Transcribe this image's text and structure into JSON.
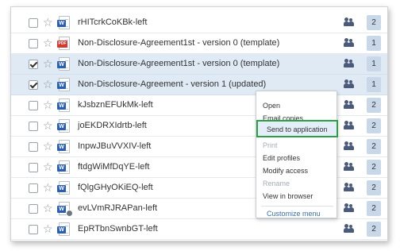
{
  "files": [
    {
      "name": "rHITcrkCoKBk-left",
      "type": "docx",
      "checked": false,
      "version": "2",
      "locked": false
    },
    {
      "name": "Non-Disclosure-Agreement1st - version 0 (template)",
      "type": "pdf",
      "checked": false,
      "version": "1",
      "locked": false
    },
    {
      "name": "Non-Disclosure-Agreement1st - version 0 (template)",
      "type": "docx",
      "checked": true,
      "version": "1",
      "locked": false
    },
    {
      "name": "Non-Disclosure-Agreement - version 1 (updated)",
      "type": "docx",
      "checked": true,
      "version": "1",
      "locked": false
    },
    {
      "name": "kJsbznEFUkMk-left",
      "type": "docx",
      "checked": false,
      "version": "2",
      "locked": false
    },
    {
      "name": "joEKDRXIdrtb-left",
      "type": "docx",
      "checked": false,
      "version": "2",
      "locked": false
    },
    {
      "name": "InpwJBuVVXIV-left",
      "type": "docx",
      "checked": false,
      "version": "2",
      "locked": false
    },
    {
      "name": "ftdgWiMfDqYE-left",
      "type": "docx",
      "checked": false,
      "version": "2",
      "locked": false
    },
    {
      "name": "fQlgGHyOKiEQ-left",
      "type": "docx",
      "checked": false,
      "version": "2",
      "locked": false
    },
    {
      "name": "evLVmRJRAPan-left",
      "type": "docx",
      "checked": false,
      "version": "2",
      "locked": true
    },
    {
      "name": "EpRTbnSwnbGT-left",
      "type": "docx",
      "checked": false,
      "version": "2",
      "locked": false
    }
  ],
  "file_type_badges": {
    "docx": "W",
    "pdf": "PDF"
  },
  "context_menu": {
    "items": [
      {
        "label": "Open",
        "disabled": false
      },
      {
        "label": "Email copies",
        "disabled": false
      },
      {
        "label": "Send to application",
        "disabled": false,
        "highlighted": true
      },
      {
        "label": "Print",
        "disabled": true
      },
      {
        "label": "Edit profiles",
        "disabled": false
      },
      {
        "label": "Modify access",
        "disabled": false
      },
      {
        "label": "Rename",
        "disabled": true
      },
      {
        "label": "View in browser",
        "disabled": false
      }
    ],
    "customize_label": "Customize menu"
  },
  "icons": {
    "star": "star-icon",
    "shared": "users-icon"
  },
  "colors": {
    "selected_row": "#dfeaf5",
    "version_badge": "#c9d8e8",
    "highlight_border": "#2ea043",
    "word_blue": "#2b5fb4",
    "pdf_red": "#d23a2f"
  }
}
